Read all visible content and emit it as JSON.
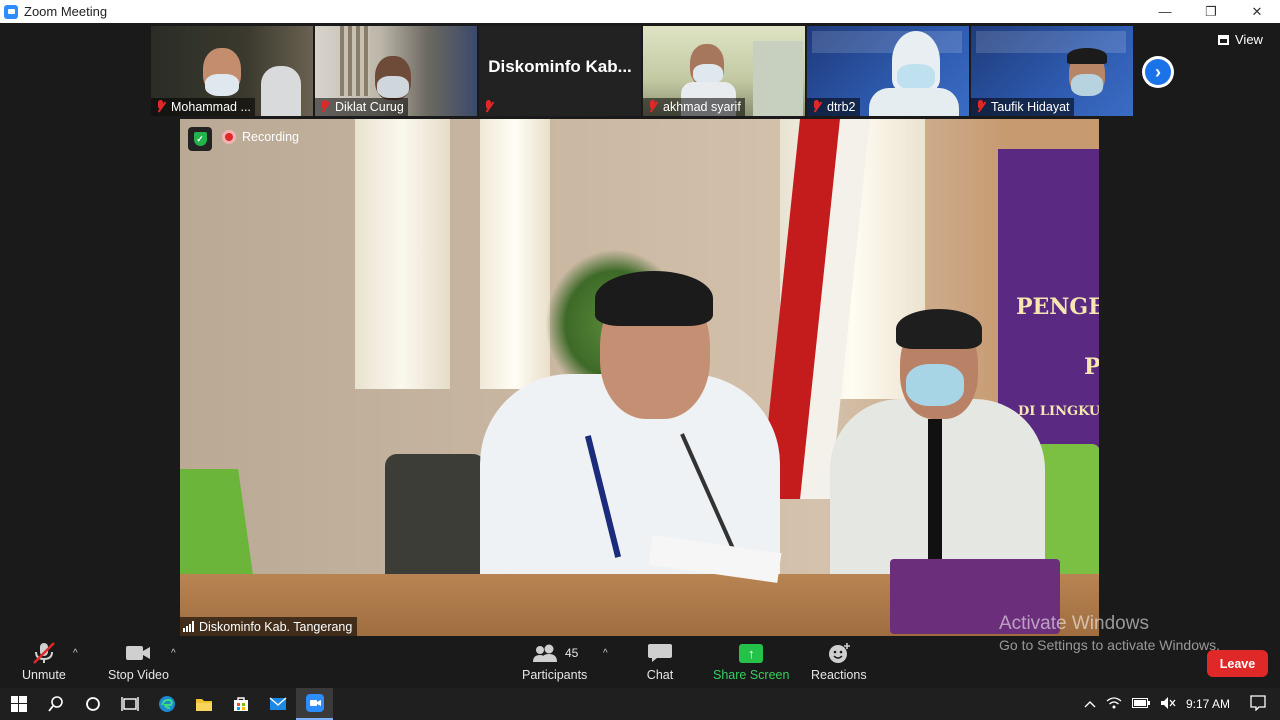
{
  "window": {
    "title": "Zoom Meeting",
    "buttons": [
      "—",
      "❐",
      "✕"
    ]
  },
  "gallery": {
    "tiles": [
      {
        "name": "Mohammad ..."
      },
      {
        "name": "Diklat Curug"
      },
      {
        "name": "",
        "display_name": "Diskominfo  Kab..."
      },
      {
        "name": "akhmad syarif"
      },
      {
        "name": "dtrb2"
      },
      {
        "name": "Taufik Hidayat"
      }
    ],
    "next_arrow": "›"
  },
  "view_button": {
    "label": "View"
  },
  "main_video": {
    "recording_label": "Recording",
    "speaker_name": "Diskominfo Kab. Tangerang",
    "banner_line1": "PENGE",
    "banner_line2": "P",
    "banner_line3": "DI LINGKU"
  },
  "watermark": {
    "line1": "Activate Windows",
    "line2": "Go to Settings to activate Windows."
  },
  "toolbar": {
    "unmute": "Unmute",
    "stop_video": "Stop Video",
    "participants": "Participants",
    "participants_count": "45",
    "chat": "Chat",
    "share_screen": "Share Screen",
    "reactions": "Reactions",
    "leave": "Leave",
    "caret": "^"
  },
  "taskbar": {
    "time": "9:17 AM"
  },
  "colors": {
    "zoom_blue": "#2d8cff",
    "leave_red": "#e02828",
    "share_green": "#25c24a"
  }
}
